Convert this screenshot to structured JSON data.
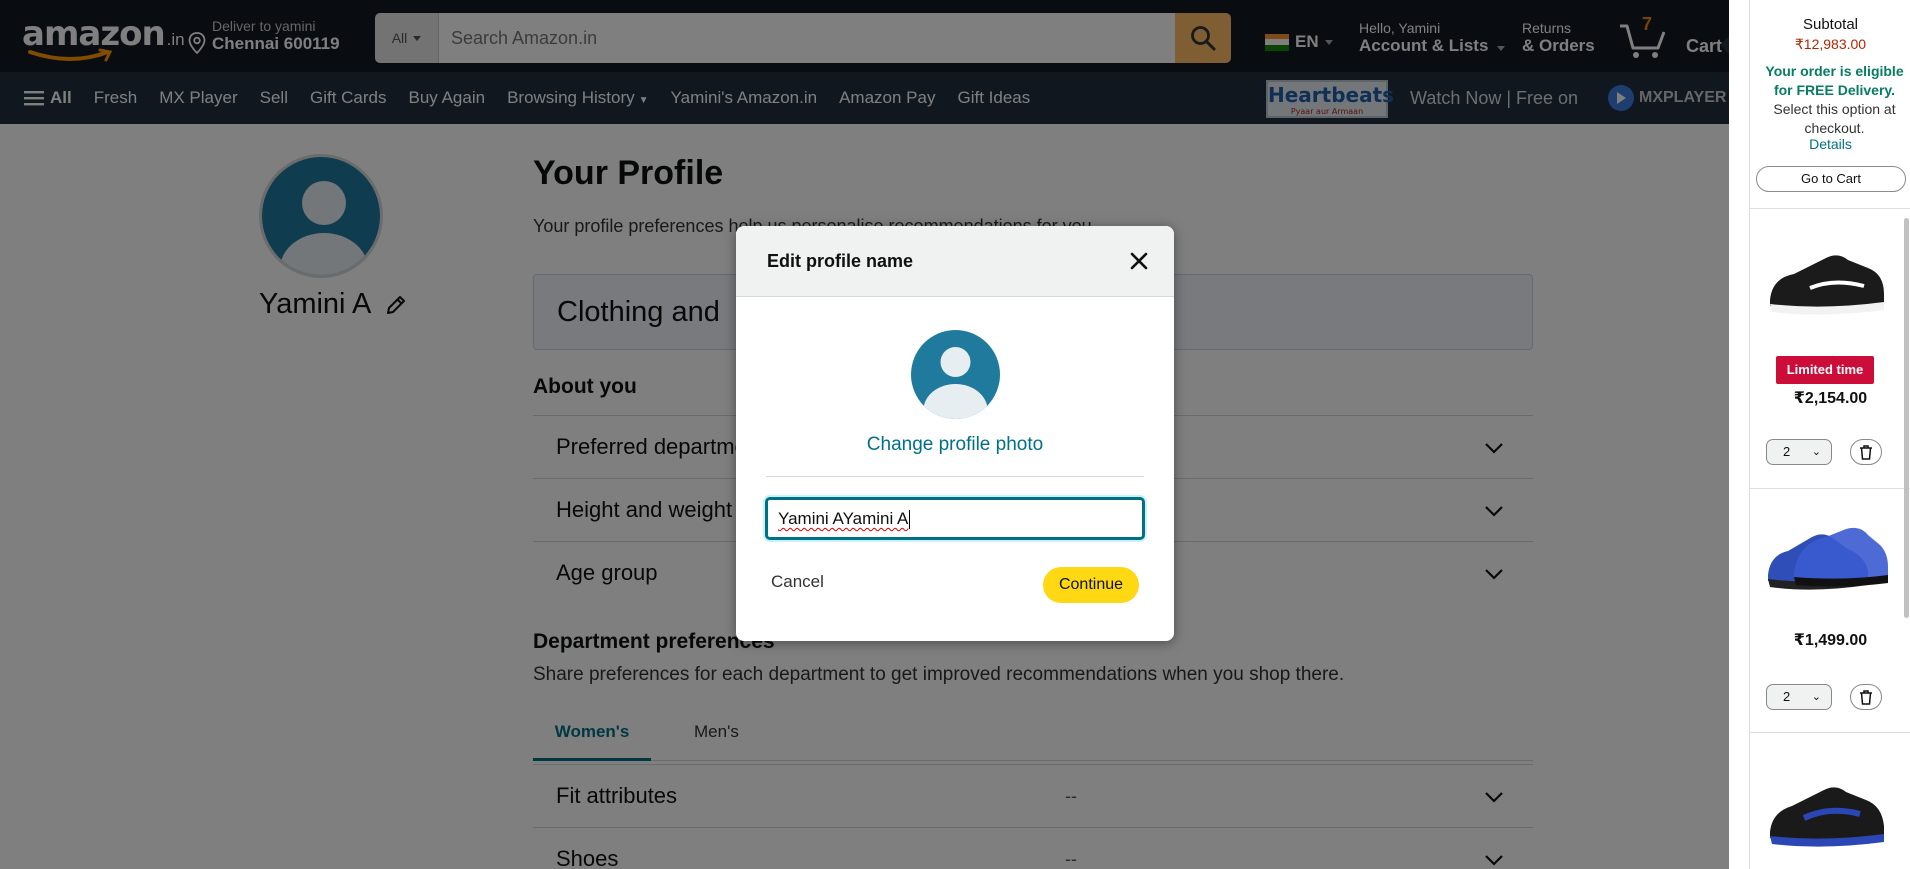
{
  "header": {
    "logo_text": "amazon",
    "logo_suffix": ".in",
    "deliver_line1": "Deliver to yamini",
    "deliver_line2": "Chennai 600119",
    "search_category": "All",
    "search_placeholder": "Search Amazon.in",
    "language": "EN",
    "account_line1": "Hello, Yamini",
    "account_line2": "Account & Lists",
    "returns_line1": "Returns",
    "returns_line2": "& Orders",
    "cart_count": "7",
    "cart_label": "Cart"
  },
  "subnav": {
    "all_label": "All",
    "items": [
      "Fresh",
      "MX Player",
      "Sell",
      "Gift Cards",
      "Buy Again",
      "Browsing History",
      "Yamini's Amazon.in",
      "Amazon Pay",
      "Gift Ideas"
    ],
    "promo_logo": "Heartbeats",
    "promo_logo_tagline": "Pyaar aur Armaan",
    "promo_text": "Watch Now | Free on",
    "promo_brand": "MXPLAYER"
  },
  "profile": {
    "name": "Yamini A",
    "title": "Your Profile",
    "subtitle": "Your profile preferences help us personalise recommendations for you.",
    "clothing_banner": "Clothing and",
    "about_heading": "About you",
    "about_rows": [
      "Preferred departments",
      "Height and weight",
      "Age group"
    ],
    "dept_heading": "Department preferences",
    "dept_desc": "Share preferences for each department to get improved recommendations when you shop there.",
    "tabs": [
      "Women's",
      "Men's"
    ],
    "pref_rows": [
      {
        "label": "Fit attributes",
        "value": "--"
      },
      {
        "label": "Shoes",
        "value": "--"
      }
    ]
  },
  "cart_panel": {
    "subtotal_label": "Subtotal",
    "subtotal_value": "₹12,983.00",
    "free_delivery_bold": "Your order is eligible for FREE Delivery.",
    "free_delivery_rest": "Select this option at checkout.",
    "details_link": "Details",
    "go_to_cart": "Go to Cart",
    "items": [
      {
        "badge": "Limited time",
        "price": "₹2,154.00",
        "qty": "2",
        "shoe": "black-white-shoe-icon"
      },
      {
        "badge": "",
        "price": "₹1,499.00",
        "qty": "2",
        "shoe": "blue-black-shoe-icon"
      },
      {
        "badge": "",
        "price": "",
        "qty": "",
        "shoe": "black-blue-shoe-icon"
      }
    ]
  },
  "modal": {
    "title": "Edit profile name",
    "change_photo": "Change profile photo",
    "input_value": "Yamini AYamini A",
    "cancel": "Cancel",
    "continue": "Continue"
  },
  "colors": {
    "nav_bg": "#131921",
    "subnav_bg": "#232f3e",
    "search_button": "#febd69",
    "link_teal": "#007185",
    "continue_yellow": "#ffd814",
    "price_red": "#b12704",
    "free_green": "#067d62",
    "limited_red": "#cc0c39",
    "avatar_blue": "#1f7a9e"
  }
}
